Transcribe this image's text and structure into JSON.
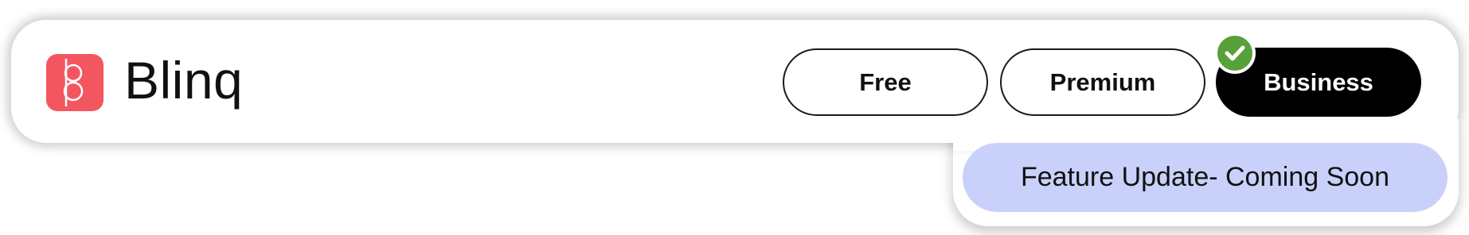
{
  "brand": {
    "name": "Blinq",
    "logo_color": "#f4565f",
    "logo_icon": "blinq-logo-icon"
  },
  "plans": {
    "free_label": "Free",
    "premium_label": "Premium",
    "business_label": "Business",
    "selected": "Business",
    "selected_color": "#000000"
  },
  "selected_badge": {
    "icon": "checkmark-icon",
    "color": "#58a03a"
  },
  "feature_update": {
    "label": "Feature Update- Coming Soon",
    "color": "#c9d1fb"
  }
}
